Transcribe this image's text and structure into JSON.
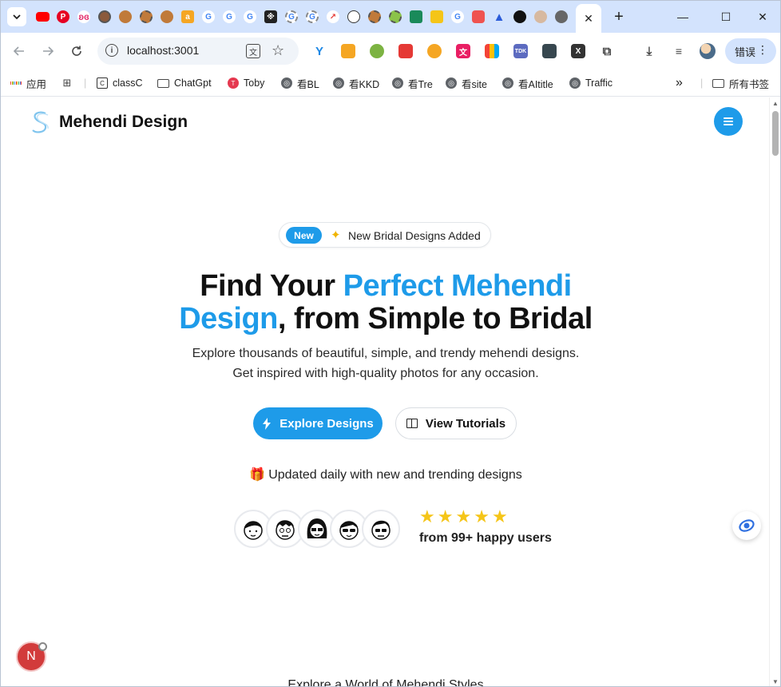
{
  "browser": {
    "tab_search_icon": "chevron-down-icon",
    "new_tab_label": "+",
    "active_tab_close": "✕",
    "window_controls": {
      "minimize": "—",
      "maximize": "☐",
      "close": "✕"
    },
    "address": {
      "url": "localhost:3001"
    },
    "extension_badge": "58",
    "profile_status": "错误",
    "bookmarks": [
      {
        "label": "应用",
        "icon": "apps-grid-icon"
      },
      {
        "label": "",
        "icon": "tab-groups-icon"
      },
      {
        "label": "classC",
        "icon": "classc-icon"
      },
      {
        "label": "ChatGpt",
        "icon": "folder-icon"
      },
      {
        "label": "Toby",
        "icon": "toby-icon"
      },
      {
        "label": "看BL",
        "icon": "globe-icon"
      },
      {
        "label": "看KKD",
        "icon": "globe-icon"
      },
      {
        "label": "看Tre",
        "icon": "globe-icon"
      },
      {
        "label": "看site",
        "icon": "globe-icon"
      },
      {
        "label": "看AItitle",
        "icon": "globe-icon"
      },
      {
        "label": "Traffic",
        "icon": "globe-icon"
      }
    ],
    "bookmarks_overflow": "»",
    "all_bookmarks": "所有书签"
  },
  "site": {
    "brand": "Mehendi Design",
    "badge": {
      "tag": "New",
      "text": "New Bridal Designs Added"
    },
    "headline": {
      "part1": "Find Your ",
      "accent": "Perfect Mehendi Design",
      "part2": ", from Simple to Bridal"
    },
    "subtext_line1": "Explore thousands of beautiful, simple, and trendy mehendi designs.",
    "subtext_line2": "Get inspired with high-quality photos for any occasion.",
    "cta_primary": "Explore Designs",
    "cta_secondary": "View Tutorials",
    "updated_text": "Updated daily with new and trending designs",
    "rating": {
      "stars": 5,
      "users_text": "from 99+ happy users"
    },
    "section_peek": "Explore a World of Mehendi Styles",
    "floating_avatar_letter": "N"
  },
  "colors": {
    "accent": "#1e9be9",
    "star": "#f5c518",
    "tabstrip": "#d3e3fd"
  }
}
